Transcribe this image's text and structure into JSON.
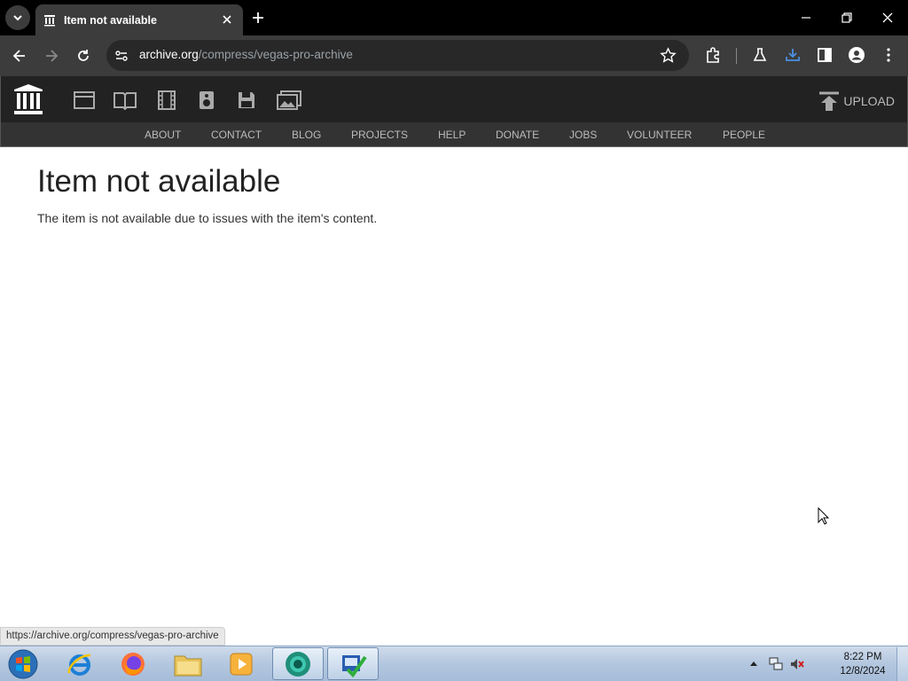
{
  "browser": {
    "tab": {
      "title": "Item not available"
    },
    "url": {
      "domain": "archive.org",
      "path": "/compress/vegas-pro-archive"
    },
    "status_url": "https://archive.org/compress/vegas-pro-archive",
    "icons": [
      "tab-search-icon",
      "archive-favicon-icon",
      "close-icon",
      "plus-icon",
      "minimize-icon",
      "restore-icon",
      "close-icon",
      "back-icon",
      "forward-icon",
      "reload-icon",
      "site-info-icon",
      "star-icon",
      "extensions-icon",
      "labs-flask-icon",
      "download-icon",
      "side-panel-icon",
      "profile-icon",
      "more-menu-icon"
    ]
  },
  "archive": {
    "media_icons": [
      "web-icon",
      "texts-icon",
      "video-icon",
      "audio-icon",
      "software-icon",
      "images-icon"
    ],
    "upload_label": "UPLOAD",
    "nav": [
      "ABOUT",
      "CONTACT",
      "BLOG",
      "PROJECTS",
      "HELP",
      "DONATE",
      "JOBS",
      "VOLUNTEER",
      "PEOPLE"
    ]
  },
  "page": {
    "heading": "Item not available",
    "message": "The item is not available due to issues with the item's content."
  },
  "taskbar": {
    "apps": [
      "internet-explorer-icon",
      "firefox-icon",
      "file-explorer-icon",
      "media-player-icon",
      "chrome-canary-icon",
      "setup-app-icon"
    ],
    "time": "8:22 PM",
    "date": "12/8/2024"
  },
  "colors": {
    "tab_bg": "#3c3c3c",
    "ia_bar": "#222222",
    "accent_download": "#4a90e2"
  }
}
